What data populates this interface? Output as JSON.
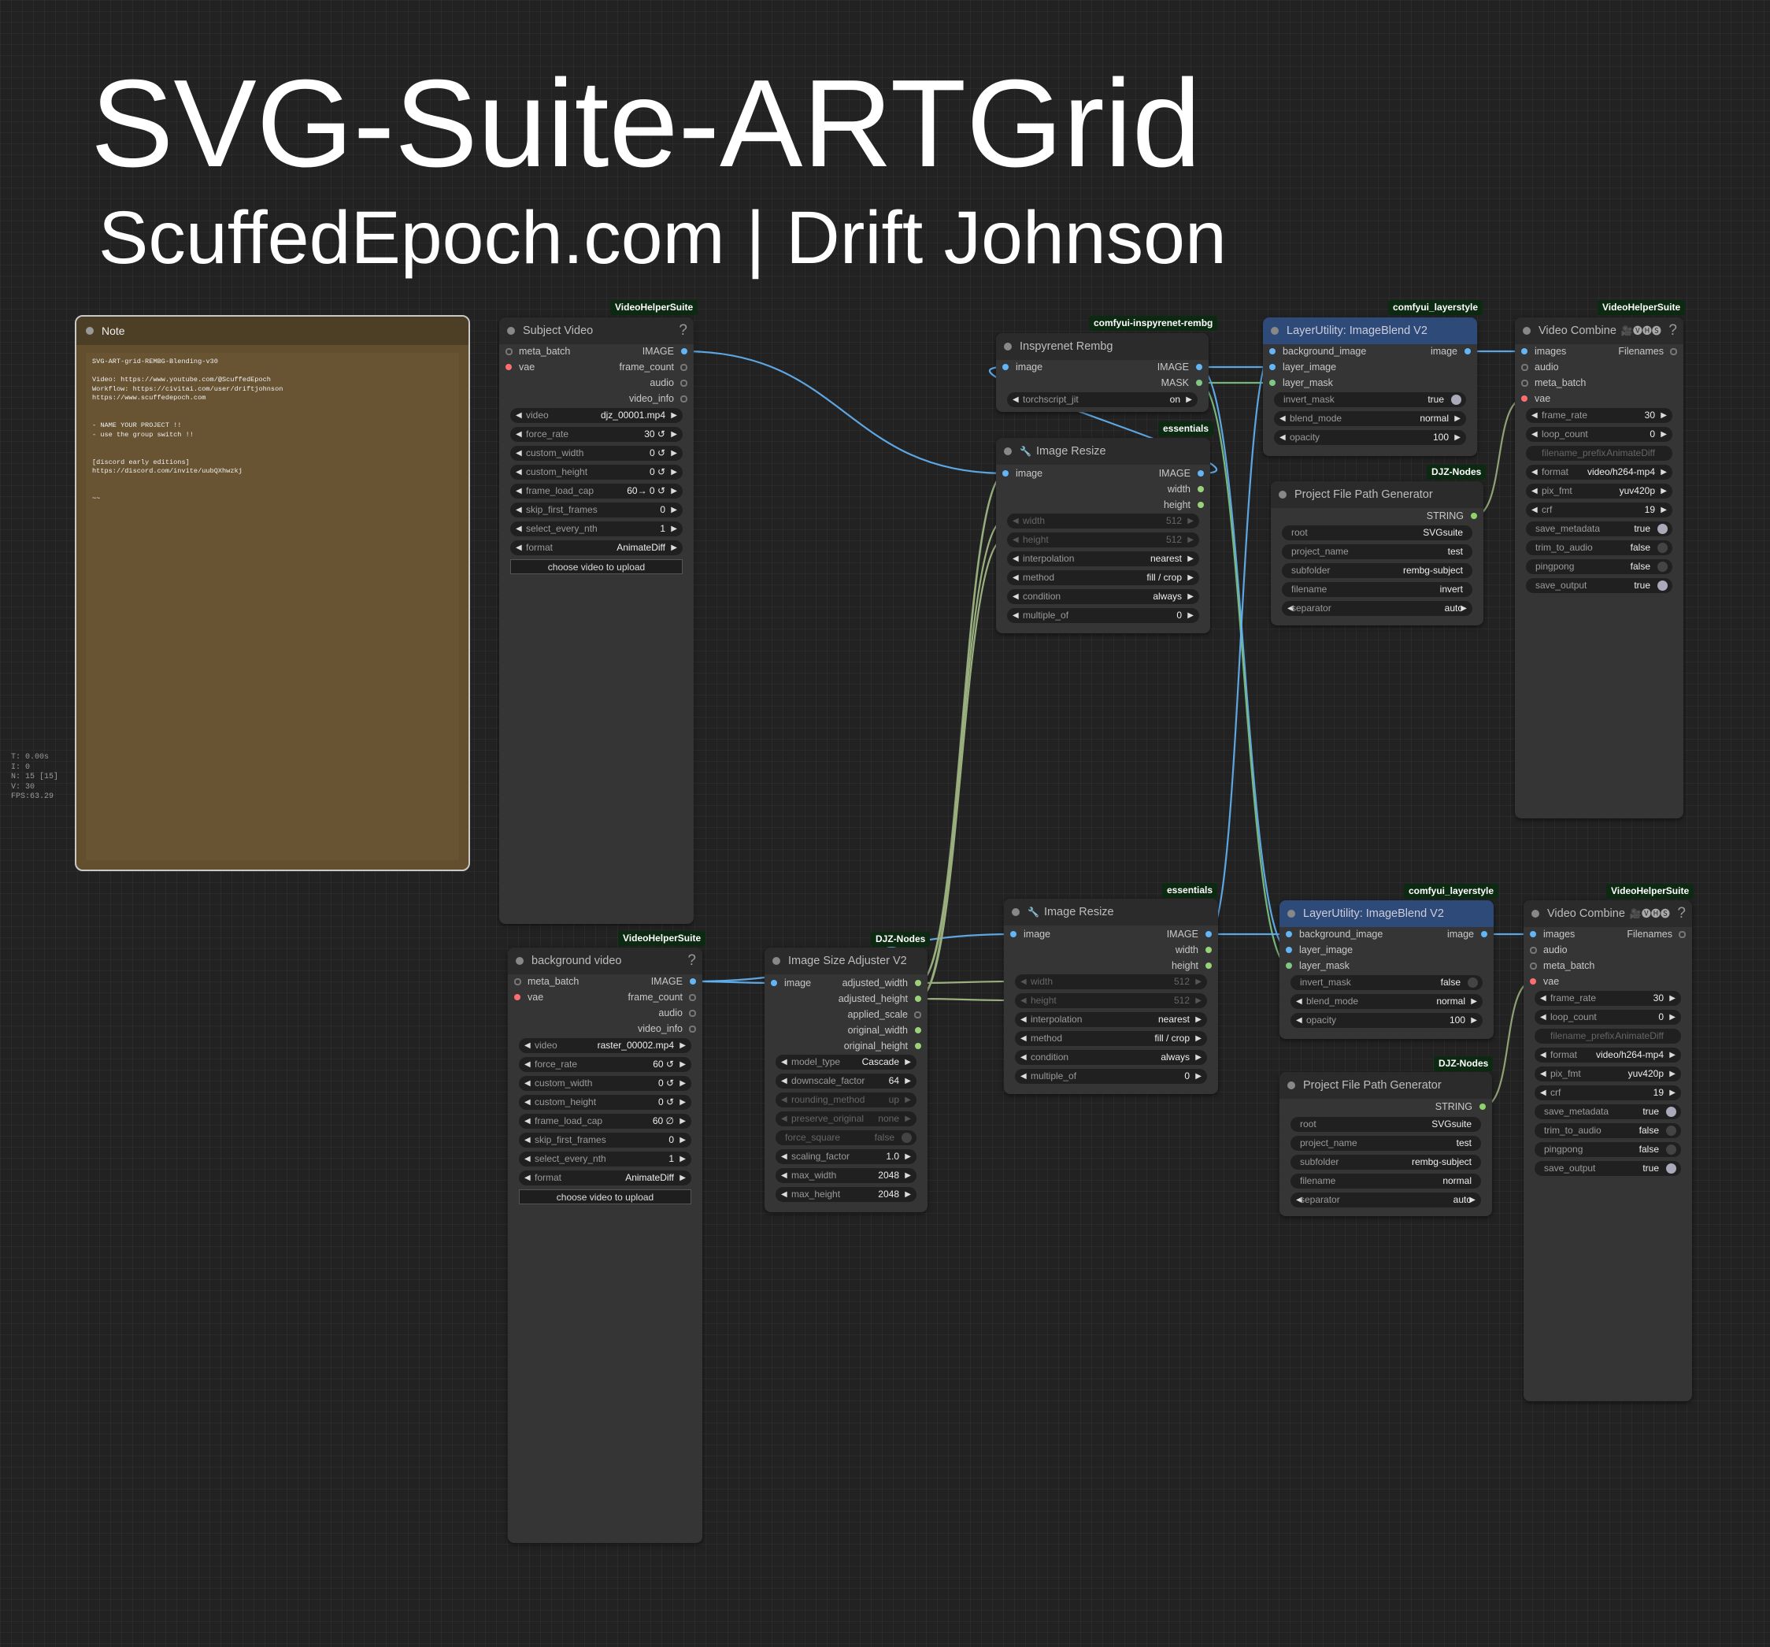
{
  "header": {
    "title": "SVG-Suite-ARTGrid",
    "subtitle": "ScuffedEpoch.com | Drift Johnson"
  },
  "stats": [
    "T: 0.00s",
    "I: 0",
    "N: 15 [15]",
    "V: 30",
    "FPS:63.29"
  ],
  "colors": {
    "canvas_bg": "#222222",
    "node_bg": "#353535",
    "node_header_blue": "#2d4a78",
    "note_bg": "#634f2e",
    "image_link": "#64b5f6",
    "mask_link": "#81c784",
    "int_link": "#9ab07f",
    "badge_bg": "#0c2a12"
  },
  "note": {
    "title": "Note",
    "body": "SVG-ART-grid-REMBG-Blending-v30\n\nVideo: https://www.youtube.com/@ScuffedEpoch\nWorkflow: https://civitai.com/user/driftjohnson\nhttps://www.scuffedepoch.com\n\n\n- NAME YOUR PROJECT !!\n- use the group switch !!\n\n\n[discord early editions]\nhttps://discord.com/invite/uubQXhwzkj\n\n\n~~"
  },
  "nodes": {
    "subject_video": {
      "badge": "VideoHelperSuite",
      "title": "Subject Video",
      "help": "?",
      "inputs": [
        "meta_batch",
        "vae"
      ],
      "outputs": [
        "IMAGE",
        "frame_count",
        "audio",
        "video_info"
      ],
      "widgets": [
        {
          "label": "video",
          "value": "djz_00001.mp4"
        },
        {
          "label": "force_rate",
          "value": "30 ↺"
        },
        {
          "label": "custom_width",
          "value": "0 ↺"
        },
        {
          "label": "custom_height",
          "value": "0 ↺"
        },
        {
          "label": "frame_load_cap",
          "value": "60→ 0 ↺"
        },
        {
          "label": "skip_first_frames",
          "value": "0"
        },
        {
          "label": "select_every_nth",
          "value": "1"
        },
        {
          "label": "format",
          "value": "AnimateDiff"
        }
      ],
      "button": "choose video to upload"
    },
    "background_video": {
      "badge": "VideoHelperSuite",
      "title": "background video",
      "help": "?",
      "inputs": [
        "meta_batch",
        "vae"
      ],
      "outputs": [
        "IMAGE",
        "frame_count",
        "audio",
        "video_info"
      ],
      "widgets": [
        {
          "label": "video",
          "value": "raster_00002.mp4"
        },
        {
          "label": "force_rate",
          "value": "60 ↺"
        },
        {
          "label": "custom_width",
          "value": "0 ↺"
        },
        {
          "label": "custom_height",
          "value": "0 ↺"
        },
        {
          "label": "frame_load_cap",
          "value": "60 ∅"
        },
        {
          "label": "skip_first_frames",
          "value": "0"
        },
        {
          "label": "select_every_nth",
          "value": "1"
        },
        {
          "label": "format",
          "value": "AnimateDiff"
        }
      ],
      "button": "choose video to upload"
    },
    "inspyrenet": {
      "badge": "comfyui-inspyrenet-rembg",
      "title": "Inspyrenet Rembg",
      "inputs": [
        "image"
      ],
      "outputs": [
        "IMAGE",
        "MASK"
      ],
      "widgets": [
        {
          "label": "torchscript_jit",
          "value": "on"
        }
      ]
    },
    "image_resize_top": {
      "badge": "essentials",
      "title": "Image Resize",
      "icon": "🔧",
      "inputs": [
        "image"
      ],
      "outputs": [
        "IMAGE",
        "width",
        "height"
      ],
      "widgets": [
        {
          "label": "width",
          "value": "512"
        },
        {
          "label": "height",
          "value": "512"
        },
        {
          "label": "interpolation",
          "value": "nearest"
        },
        {
          "label": "method",
          "value": "fill / crop"
        },
        {
          "label": "condition",
          "value": "always"
        },
        {
          "label": "multiple_of",
          "value": "0"
        }
      ]
    },
    "image_resize_bottom": {
      "badge": "essentials",
      "title": "Image Resize",
      "icon": "🔧",
      "inputs": [
        "image"
      ],
      "outputs": [
        "IMAGE",
        "width",
        "height"
      ],
      "widgets": [
        {
          "label": "width",
          "value": "512"
        },
        {
          "label": "height",
          "value": "512"
        },
        {
          "label": "interpolation",
          "value": "nearest"
        },
        {
          "label": "method",
          "value": "fill / crop"
        },
        {
          "label": "condition",
          "value": "always"
        },
        {
          "label": "multiple_of",
          "value": "0"
        }
      ]
    },
    "size_adjuster": {
      "badge": "DJZ-Nodes",
      "title": "Image Size Adjuster V2",
      "inputs": [
        "image"
      ],
      "outputs": [
        "adjusted_width",
        "adjusted_height",
        "applied_scale",
        "original_width",
        "original_height"
      ],
      "widgets": [
        {
          "label": "model_type",
          "value": "Cascade"
        },
        {
          "label": "downscale_factor",
          "value": "64"
        },
        {
          "label": "rounding_method",
          "value": "up"
        },
        {
          "label": "preserve_original",
          "value": "none"
        },
        {
          "label": "force_square",
          "value": "false"
        },
        {
          "label": "scaling_factor",
          "value": "1.0"
        },
        {
          "label": "max_width",
          "value": "2048"
        },
        {
          "label": "max_height",
          "value": "2048"
        }
      ]
    },
    "blend_top": {
      "badge": "comfyui_layerstyle",
      "title": "LayerUtility: ImageBlend V2",
      "inputs": [
        "background_image",
        "layer_image",
        "layer_mask"
      ],
      "outputs": [
        "image"
      ],
      "widgets": [
        {
          "label": "invert_mask",
          "value": "true"
        },
        {
          "label": "blend_mode",
          "value": "normal"
        },
        {
          "label": "opacity",
          "value": "100"
        }
      ]
    },
    "blend_bottom": {
      "badge": "comfyui_layerstyle",
      "title": "LayerUtility: ImageBlend V2",
      "inputs": [
        "background_image",
        "layer_image",
        "layer_mask"
      ],
      "outputs": [
        "image"
      ],
      "widgets": [
        {
          "label": "invert_mask",
          "value": "false"
        },
        {
          "label": "blend_mode",
          "value": "normal"
        },
        {
          "label": "opacity",
          "value": "100"
        }
      ]
    },
    "path_top": {
      "badge": "DJZ-Nodes",
      "title": "Project File Path Generator",
      "outputs": [
        "STRING"
      ],
      "widgets": [
        {
          "label": "root",
          "value": "SVGsuite"
        },
        {
          "label": "project_name",
          "value": "test"
        },
        {
          "label": "subfolder",
          "value": "rembg-subject"
        },
        {
          "label": "filename",
          "value": "invert"
        },
        {
          "label": "separator",
          "value": "auto"
        }
      ]
    },
    "path_bottom": {
      "badge": "DJZ-Nodes",
      "title": "Project File Path Generator",
      "outputs": [
        "STRING"
      ],
      "widgets": [
        {
          "label": "root",
          "value": "SVGsuite"
        },
        {
          "label": "project_name",
          "value": "test"
        },
        {
          "label": "subfolder",
          "value": "rembg-subject"
        },
        {
          "label": "filename",
          "value": "normal"
        },
        {
          "label": "separator",
          "value": "auto"
        }
      ]
    },
    "combine_top": {
      "badge": "VideoHelperSuite",
      "title": "Video Combine",
      "icons": "🎥🅥🅗🅢",
      "help": "?",
      "inputs": [
        "images",
        "audio",
        "meta_batch",
        "vae"
      ],
      "outputs": [
        "Filenames"
      ],
      "widgets": [
        {
          "label": "frame_rate",
          "value": "30"
        },
        {
          "label": "loop_count",
          "value": "0"
        },
        {
          "label": "filename_prefix",
          "value": "AnimateDiff"
        },
        {
          "label": "format",
          "value": "video/h264-mp4"
        },
        {
          "label": "pix_fmt",
          "value": "yuv420p"
        },
        {
          "label": "crf",
          "value": "19"
        },
        {
          "label": "save_metadata",
          "value": "true"
        },
        {
          "label": "trim_to_audio",
          "value": "false"
        },
        {
          "label": "pingpong",
          "value": "false"
        },
        {
          "label": "save_output",
          "value": "true"
        }
      ]
    },
    "combine_bottom": {
      "badge": "VideoHelperSuite",
      "title": "Video Combine",
      "icons": "🎥🅥🅗🅢",
      "help": "?",
      "inputs": [
        "images",
        "audio",
        "meta_batch",
        "vae"
      ],
      "outputs": [
        "Filenames"
      ],
      "widgets": [
        {
          "label": "frame_rate",
          "value": "30"
        },
        {
          "label": "loop_count",
          "value": "0"
        },
        {
          "label": "filename_prefix",
          "value": "AnimateDiff"
        },
        {
          "label": "format",
          "value": "video/h264-mp4"
        },
        {
          "label": "pix_fmt",
          "value": "yuv420p"
        },
        {
          "label": "crf",
          "value": "19"
        },
        {
          "label": "save_metadata",
          "value": "true"
        },
        {
          "label": "trim_to_audio",
          "value": "false"
        },
        {
          "label": "pingpong",
          "value": "false"
        },
        {
          "label": "save_output",
          "value": "true"
        }
      ]
    }
  }
}
